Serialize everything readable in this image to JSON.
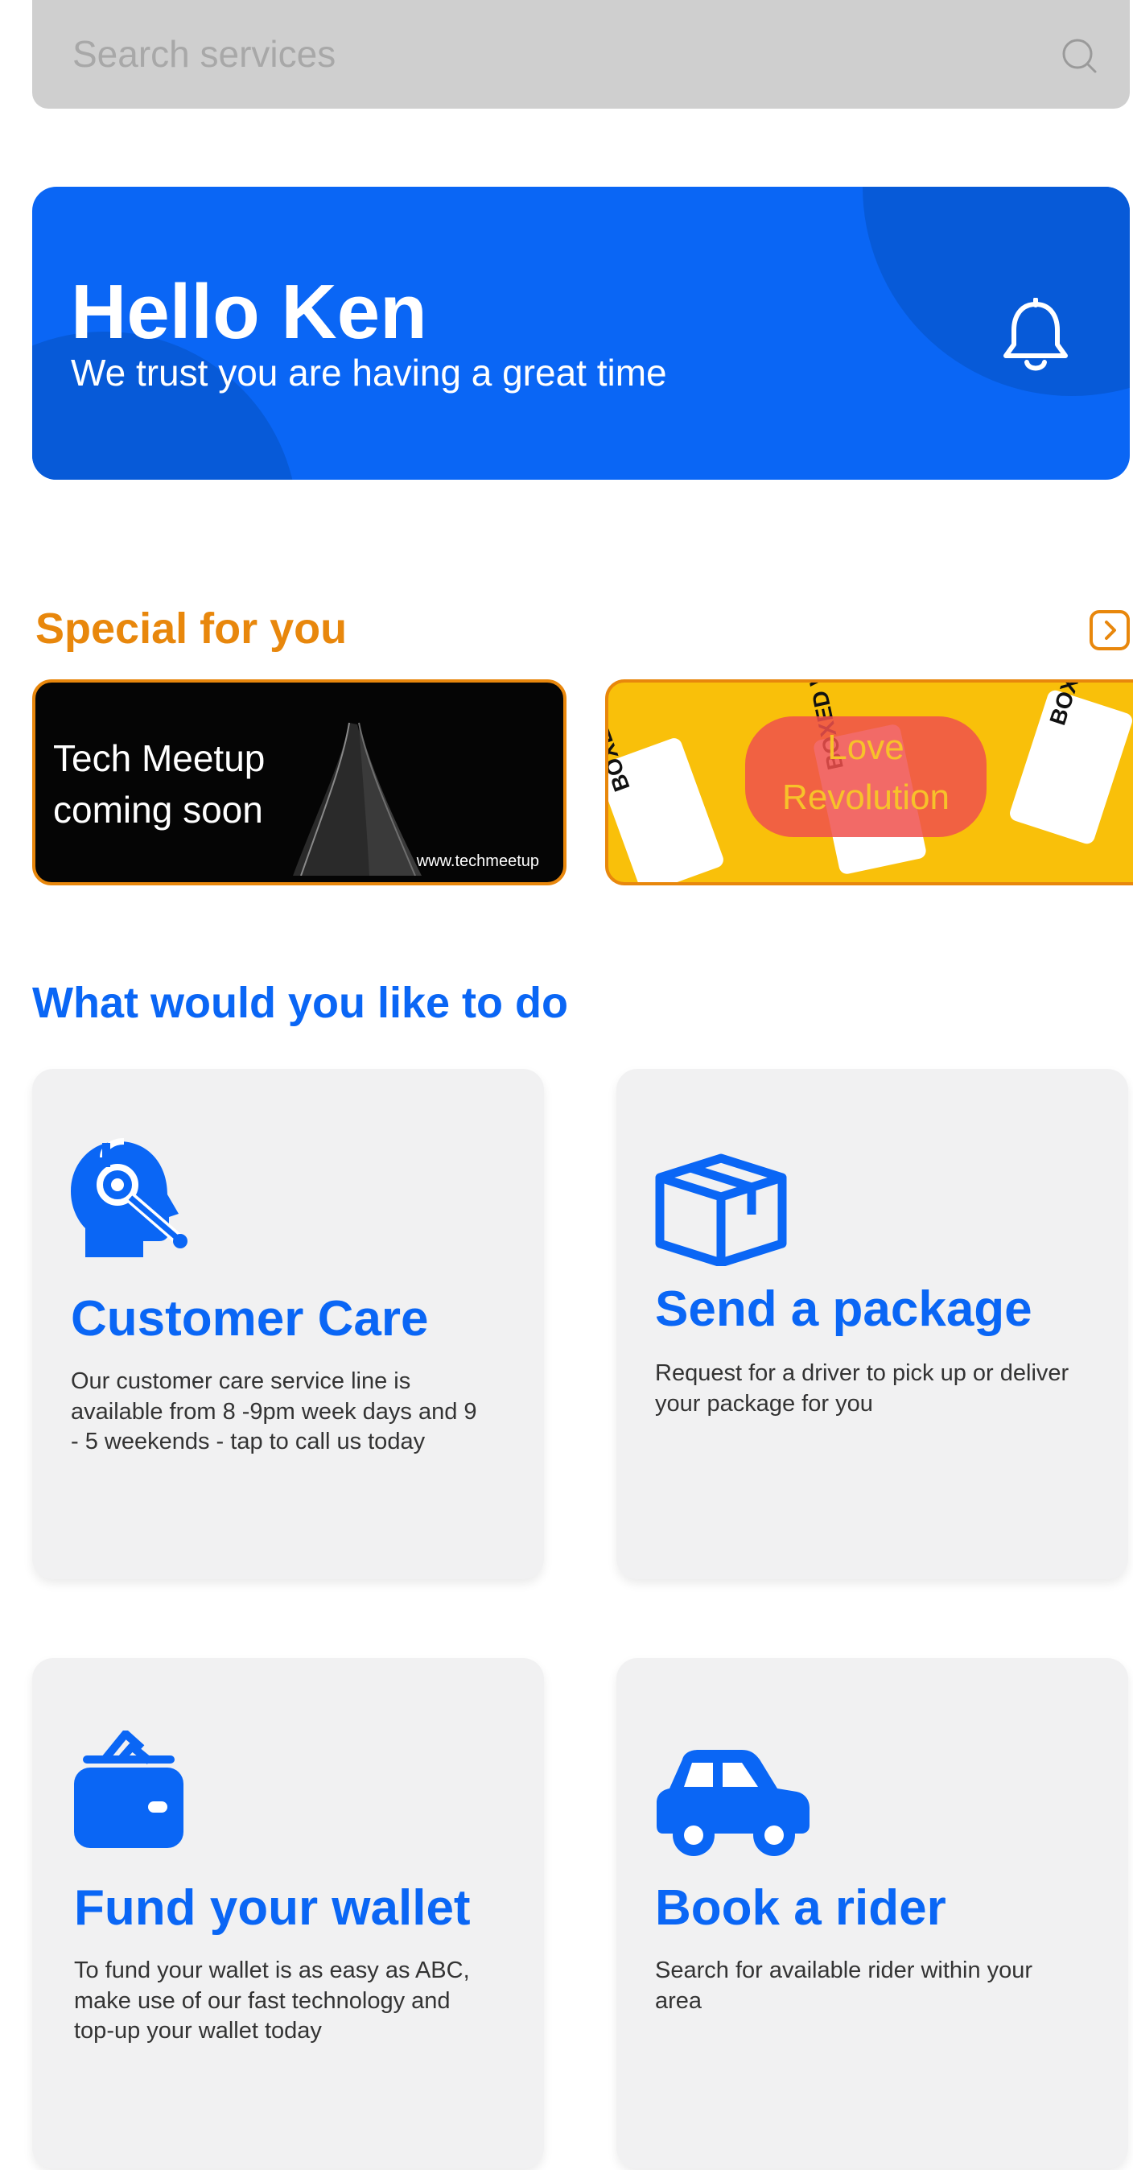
{
  "search": {
    "placeholder": "Search services",
    "icon": "search-icon"
  },
  "hero": {
    "greeting": "Hello Ken",
    "subtitle": "We trust you are having a great time",
    "icon": "bell-icon",
    "color": "#0a66f5"
  },
  "special": {
    "title": "Special for you",
    "accent": "#e8870c",
    "next_icon": "chevron-right-icon",
    "promos": [
      {
        "title": "Tech Meetup coming soon",
        "url": "www.techmeetup"
      },
      {
        "title": "Love Revolution",
        "brand": "BOXED WATER"
      }
    ]
  },
  "actions": {
    "title": "What would you like to do",
    "cards": [
      {
        "icon": "customer-support-icon",
        "title": "Customer Care",
        "description": "Our customer care service line is available from 8 -9pm week days and 9 - 5 weekends - tap to call us today"
      },
      {
        "icon": "package-icon",
        "title": "Send a package",
        "description": "Request for a driver to pick up or deliver your package for you"
      },
      {
        "icon": "wallet-icon",
        "title": "Fund your wallet",
        "description": "To fund your wallet is as easy as ABC, make use of our fast technology and top-up your wallet today"
      },
      {
        "icon": "car-icon",
        "title": "Book a rider",
        "description": "Search for available rider within your area"
      }
    ]
  }
}
